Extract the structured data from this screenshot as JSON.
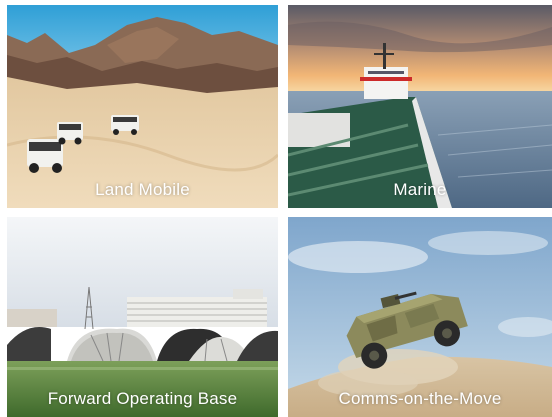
{
  "tiles": [
    {
      "id": "land-mobile",
      "label": "Land Mobile"
    },
    {
      "id": "marine",
      "label": "Marine"
    },
    {
      "id": "forward-operating-base",
      "label": "Forward Operating Base"
    },
    {
      "id": "comms-on-the-move",
      "label": "Comms-on-the-Move"
    }
  ],
  "colors": {
    "label_text": "#ffffff",
    "desert_sky": "#3fa8d8",
    "desert_sand": "#e8cfa6",
    "ocean": "#6f8aa6",
    "ship_green": "#2f5a45",
    "sunset": "#f0b070",
    "fob_grass": "#4f7a3a",
    "fob_sky": "#dfe6ee",
    "comms_sky": "#9fc0dc",
    "vehicle_camo": "#8a8a5a"
  }
}
